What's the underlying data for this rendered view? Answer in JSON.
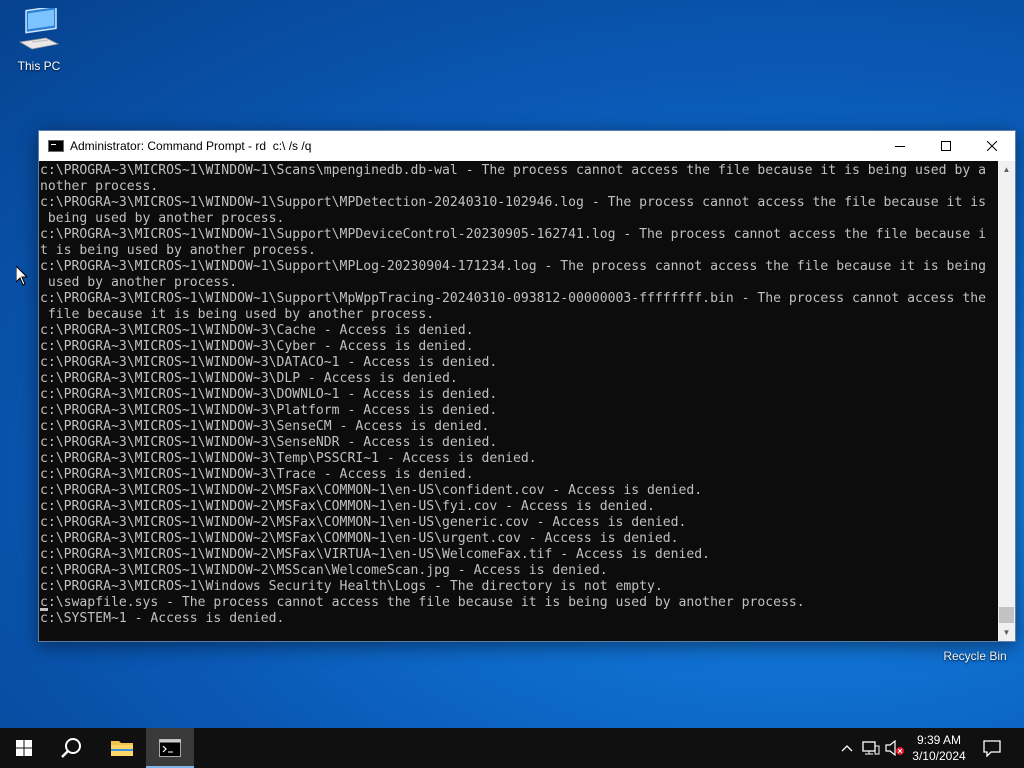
{
  "desktop": {
    "icons": [
      {
        "label": "This PC",
        "icon": "computer-icon"
      },
      {
        "label": "Recycle Bin",
        "icon": "recycle-bin-icon"
      }
    ]
  },
  "window": {
    "title": "Administrator: Command Prompt - rd  c:\\ /s /q",
    "console_lines": [
      "c:\\PROGRA~3\\MICROS~1\\WINDOW~1\\Scans\\mpenginedb.db-wal - The process cannot access the file because it is being used by a",
      "nother process.",
      "c:\\PROGRA~3\\MICROS~1\\WINDOW~1\\Support\\MPDetection-20240310-102946.log - The process cannot access the file because it is",
      " being used by another process.",
      "c:\\PROGRA~3\\MICROS~1\\WINDOW~1\\Support\\MPDeviceControl-20230905-162741.log - The process cannot access the file because i",
      "t is being used by another process.",
      "c:\\PROGRA~3\\MICROS~1\\WINDOW~1\\Support\\MPLog-20230904-171234.log - The process cannot access the file because it is being",
      " used by another process.",
      "c:\\PROGRA~3\\MICROS~1\\WINDOW~1\\Support\\MpWppTracing-20240310-093812-00000003-ffffffff.bin - The process cannot access the",
      " file because it is being used by another process.",
      "c:\\PROGRA~3\\MICROS~1\\WINDOW~3\\Cache - Access is denied.",
      "c:\\PROGRA~3\\MICROS~1\\WINDOW~3\\Cyber - Access is denied.",
      "c:\\PROGRA~3\\MICROS~1\\WINDOW~3\\DATACO~1 - Access is denied.",
      "c:\\PROGRA~3\\MICROS~1\\WINDOW~3\\DLP - Access is denied.",
      "c:\\PROGRA~3\\MICROS~1\\WINDOW~3\\DOWNLO~1 - Access is denied.",
      "c:\\PROGRA~3\\MICROS~1\\WINDOW~3\\Platform - Access is denied.",
      "c:\\PROGRA~3\\MICROS~1\\WINDOW~3\\SenseCM - Access is denied.",
      "c:\\PROGRA~3\\MICROS~1\\WINDOW~3\\SenseNDR - Access is denied.",
      "c:\\PROGRA~3\\MICROS~1\\WINDOW~3\\Temp\\PSSCRI~1 - Access is denied.",
      "c:\\PROGRA~3\\MICROS~1\\WINDOW~3\\Trace - Access is denied.",
      "c:\\PROGRA~3\\MICROS~1\\WINDOW~2\\MSFax\\COMMON~1\\en-US\\confident.cov - Access is denied.",
      "c:\\PROGRA~3\\MICROS~1\\WINDOW~2\\MSFax\\COMMON~1\\en-US\\fyi.cov - Access is denied.",
      "c:\\PROGRA~3\\MICROS~1\\WINDOW~2\\MSFax\\COMMON~1\\en-US\\generic.cov - Access is denied.",
      "c:\\PROGRA~3\\MICROS~1\\WINDOW~2\\MSFax\\COMMON~1\\en-US\\urgent.cov - Access is denied.",
      "c:\\PROGRA~3\\MICROS~1\\WINDOW~2\\MSFax\\VIRTUA~1\\en-US\\WelcomeFax.tif - Access is denied.",
      "c:\\PROGRA~3\\MICROS~1\\WINDOW~2\\MSScan\\WelcomeScan.jpg - Access is denied.",
      "c:\\PROGRA~3\\MICROS~1\\Windows Security Health\\Logs - The directory is not empty.",
      "c:\\swapfile.sys - The process cannot access the file because it is being used by another process.",
      "c:\\SYSTEM~1 - Access is denied."
    ]
  },
  "taskbar": {
    "items": [
      "start-icon",
      "search-icon",
      "file-explorer-icon",
      "command-prompt-icon"
    ],
    "clock": {
      "time": "9:39 AM",
      "date": "3/10/2024"
    }
  },
  "colors": {
    "console_bg": "#0c0c0c",
    "console_text": "#c0c0c0",
    "taskbar": "#101010",
    "desktop": "#0a58b4"
  }
}
